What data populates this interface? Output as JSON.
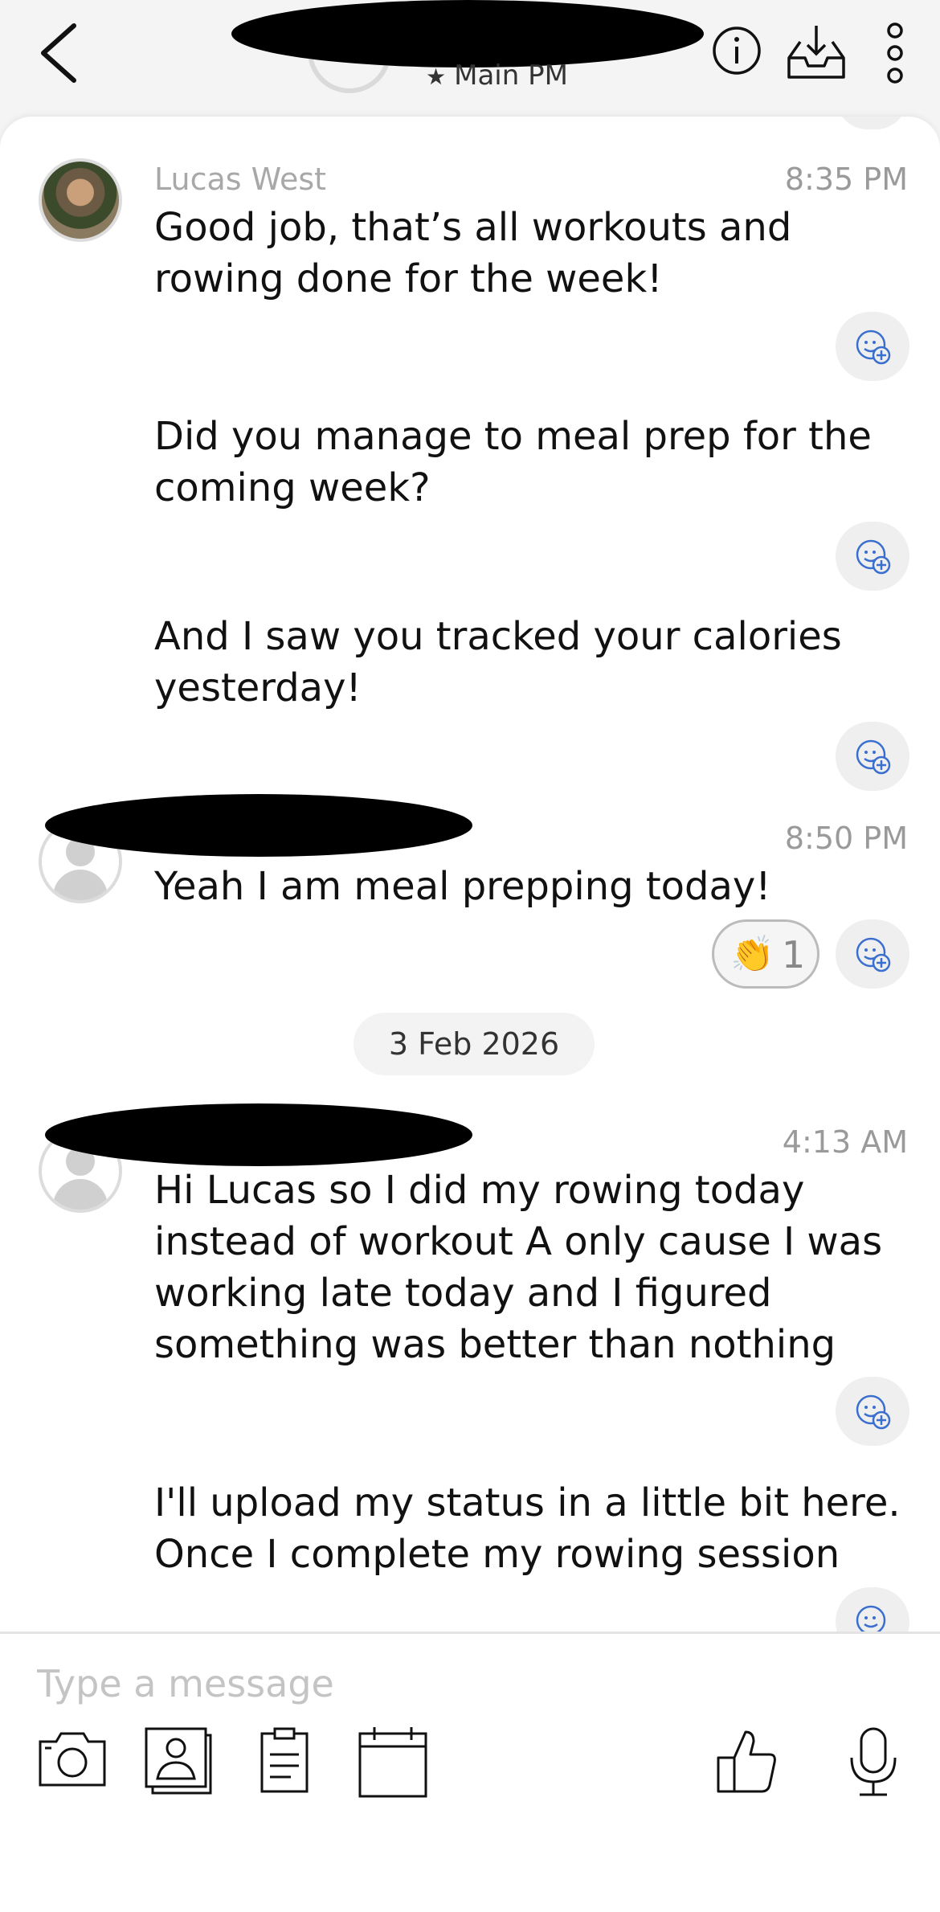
{
  "header": {
    "subtitle": "Main PM",
    "icons": [
      "back-icon",
      "info-icon",
      "inbox-download-icon",
      "more-vertical-icon"
    ]
  },
  "messages": [
    {
      "sender": "Lucas West",
      "time": "8:35 PM",
      "text": "Good job, that’s all workouts and rowing done for the week!"
    },
    {
      "text": "Did you manage to meal prep for the coming week?"
    },
    {
      "text": "And I saw you tracked your calories yesterday!"
    },
    {
      "time": "8:50 PM",
      "text": "Yeah I am meal prepping today!",
      "reaction": {
        "emoji": "👏",
        "count": "1"
      }
    },
    {
      "time": "4:13 AM",
      "text": "Hi Lucas so I did my rowing today instead of workout A only cause I was working late today and I figured something was better than nothing"
    },
    {
      "text": "I'll upload my status in a little bit here. Once I complete my rowing session"
    }
  ],
  "date_divider": "3 Feb 2026",
  "composer": {
    "placeholder": "Type a message",
    "tools": [
      "camera-icon",
      "contact-card-icon",
      "document-icon",
      "calendar-icon",
      "thumbs-up-icon",
      "microphone-icon"
    ]
  },
  "colors": {
    "accent": "#3a6fd0",
    "text": "#111111",
    "muted": "#9a9a9a"
  }
}
